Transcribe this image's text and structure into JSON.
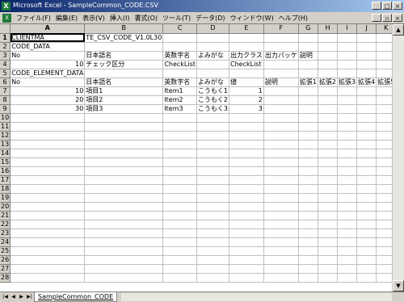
{
  "window": {
    "title": "Microsoft Excel - SampleCommon_CODE.CSV"
  },
  "menubar": {
    "items": [
      "ファイル(F)",
      "編集(E)",
      "表示(V)",
      "挿入(I)",
      "書式(O)",
      "ツール(T)",
      "データ(D)",
      "ウィンドウ(W)",
      "ヘルプ(H)"
    ]
  },
  "columns": [
    "A",
    "B",
    "C",
    "D",
    "E",
    "F",
    "G",
    "H",
    "I",
    "J",
    "K"
  ],
  "rows": [
    [
      "CLIENTMA",
      "TE_CSV_CODE_V1.0L30",
      "",
      "",
      "",
      "",
      "",
      "",
      "",
      "",
      ""
    ],
    [
      "CODE_DATA",
      "",
      "",
      "",
      "",
      "",
      "",
      "",
      "",
      "",
      ""
    ],
    [
      "No",
      "日本語名",
      "英数字名",
      "よみがな",
      "出力クラス",
      "出力パッケ",
      "説明",
      "",
      "",
      "",
      ""
    ],
    [
      "10",
      "チェック区分",
      "CheckList",
      "",
      "CheckList",
      "",
      "",
      "",
      "",
      "",
      ""
    ],
    [
      "CODE_ELEMENT_DATA",
      "",
      "",
      "",
      "",
      "",
      "",
      "",
      "",
      "",
      ""
    ],
    [
      "No",
      "日本語名",
      "英数字名",
      "よみがな",
      "値",
      "説明",
      "拡張1",
      "拡張2",
      "拡張3",
      "拡張4",
      "拡張5"
    ],
    [
      "10",
      "項目1",
      "Item1",
      "こうもく1",
      "1",
      "",
      "",
      "",
      "",
      "",
      ""
    ],
    [
      "20",
      "項目2",
      "Item2",
      "こうもく2",
      "2",
      "",
      "",
      "",
      "",
      "",
      ""
    ],
    [
      "30",
      "項目3",
      "Item3",
      "こうもく3",
      "3",
      "",
      "",
      "",
      "",
      "",
      ""
    ]
  ],
  "row_count": 28,
  "sheet_tab": "SampleCommon_CODE"
}
